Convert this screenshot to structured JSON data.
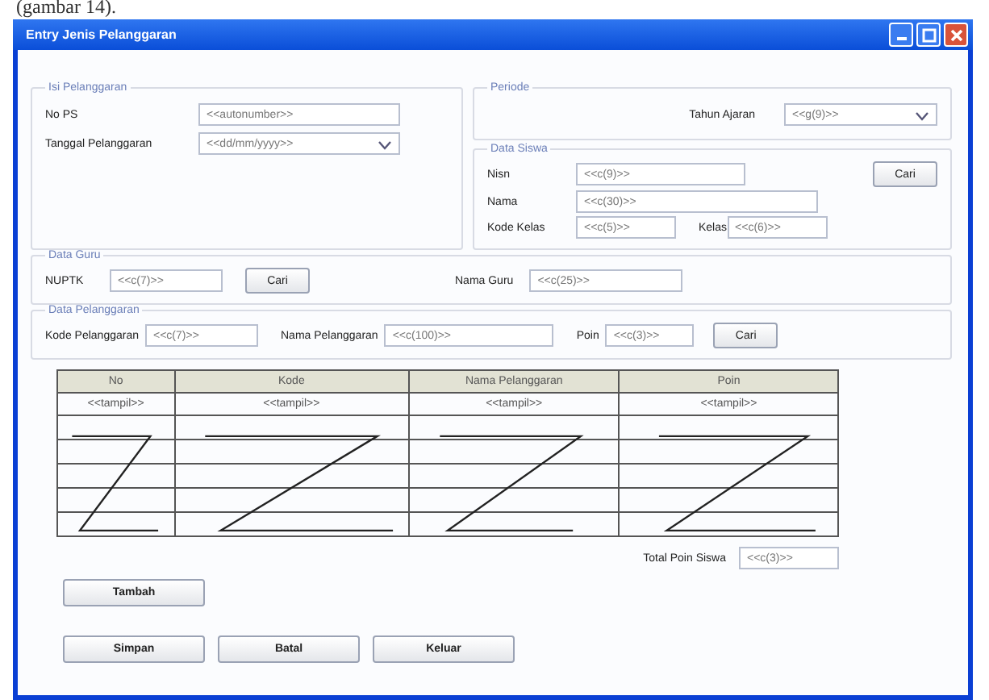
{
  "caption": "(gambar 14).",
  "window": {
    "title": "Entry Jenis Pelanggaran"
  },
  "isi_pelanggaran": {
    "legend": "Isi Pelanggaran",
    "fields": [
      {
        "label": "No PS",
        "value": "<<autonumber>>",
        "kind": "text"
      },
      {
        "label": "Tanggal Pelanggaran",
        "value": "<<dd/mm/yyyy>>",
        "kind": "dropdown"
      }
    ]
  },
  "periode": {
    "legend": "Periode",
    "label": "Tahun Ajaran",
    "value": "<<g(9)>>"
  },
  "data_siswa": {
    "legend": "Data Siswa",
    "nisn_label": "Nisn",
    "nisn_value": "<<c(9)>>",
    "button": "Cari",
    "nama_label": "Nama",
    "nama_value": "<<c(30)>>",
    "kode_kelas_label": "Kode Kelas",
    "kode_kelas_value": "<<c(5)>>",
    "kelas_label": "Kelas",
    "kelas_value": "<<c(6)>>"
  },
  "data_guru": {
    "legend": "Data Guru",
    "nuptk_label": "NUPTK",
    "nuptk_value": "<<c(7)>>",
    "button": "Cari",
    "nama_label": "Nama Guru",
    "nama_value": "<<c(25)>>"
  },
  "data_pelanggaran": {
    "legend": "Data Pelanggaran",
    "kode_label": "Kode Pelanggaran",
    "kode_value": "<<c(7)>>",
    "nama_label": "Nama Pelanggaran",
    "nama_value": "<<c(100)>>",
    "poin_label": "Poin",
    "poin_value": "<<c(3)>>",
    "button": "Cari"
  },
  "table": {
    "columns": [
      "No",
      "Kode",
      "Nama Pelanggaran",
      "Poin"
    ],
    "rows": [
      [
        "<<tampil>>",
        "<<tampil>>",
        "<<tampil>>",
        "<<tampil>>"
      ]
    ]
  },
  "total": {
    "label": "Total Poin Siswa",
    "value": "<<c(3)>>"
  },
  "add_button": "Tambah",
  "buttons": [
    "Simpan",
    "Batal",
    "Keluar"
  ]
}
